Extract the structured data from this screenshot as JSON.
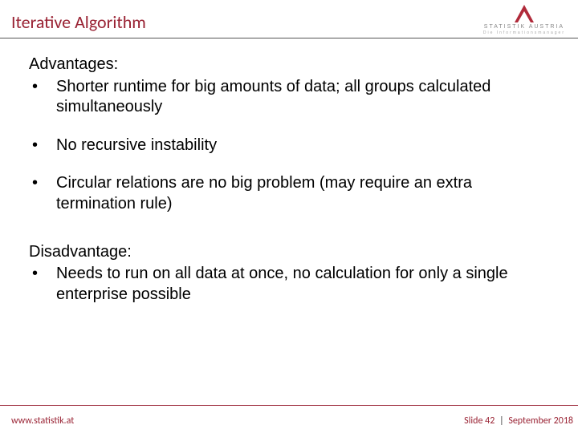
{
  "header": {
    "title": "Iterative Algorithm",
    "logo_text": "STATISTIK AUSTRIA",
    "logo_sub": "Die Informationsmanager"
  },
  "content": {
    "advantages_label": "Advantages:",
    "adv": [
      "Shorter runtime for big amounts of data; all groups calculated simultaneously",
      "No recursive instability",
      "Circular relations are no big problem (may require an extra termination rule)"
    ],
    "disadvantage_label": "Disadvantage:",
    "dis": [
      "Needs to run on all data at once, no calculation for only a single enterprise possible"
    ]
  },
  "footer": {
    "url": "www.statistik.at",
    "slide_label": "Slide 42",
    "date": "September 2018"
  }
}
